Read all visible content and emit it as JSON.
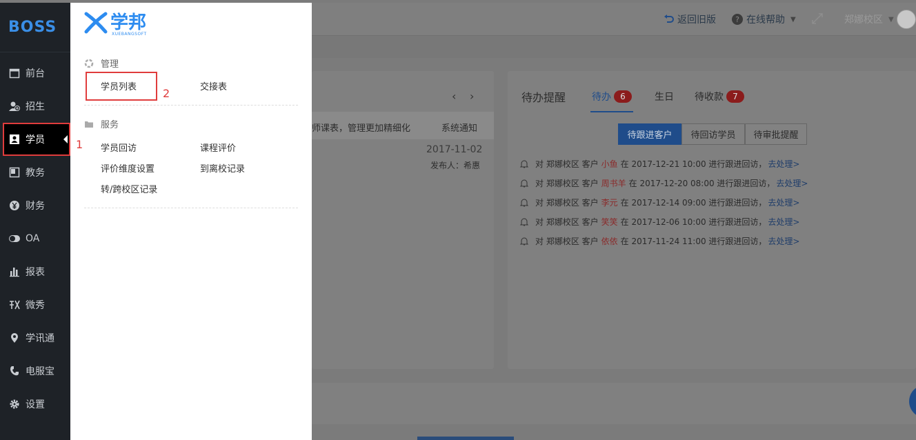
{
  "app": {
    "logo": "BOSS"
  },
  "sidebar": {
    "items": [
      {
        "label": "前台",
        "icon": "calendar-icon"
      },
      {
        "label": "招生",
        "icon": "user-add-icon"
      },
      {
        "label": "学员",
        "icon": "contact-card-icon"
      },
      {
        "label": "教务",
        "icon": "book-icon"
      },
      {
        "label": "财务",
        "icon": "yen-icon"
      },
      {
        "label": "OA",
        "icon": "toggle-icon"
      },
      {
        "label": "报表",
        "icon": "bar-chart-icon"
      },
      {
        "label": "微秀",
        "icon": "wei-xiu-icon"
      },
      {
        "label": "学讯通",
        "icon": "location-pin-icon"
      },
      {
        "label": "电服宝",
        "icon": "phone-icon"
      },
      {
        "label": "设置",
        "icon": "gear-icon"
      }
    ],
    "active_index": 2
  },
  "annotations": {
    "one": "1",
    "two": "2"
  },
  "submenu": {
    "brand_cn": "学邦",
    "brand_en": "XUEBANGSOFT",
    "sections": [
      {
        "title": "管理",
        "links": [
          "学员列表",
          "交接表"
        ]
      },
      {
        "title": "服务",
        "links": [
          "学员回访",
          "课程评价",
          "评价维度设置",
          "到离校记录",
          "转/跨校区记录"
        ]
      }
    ]
  },
  "topbar": {
    "back_old": "返回旧版",
    "help": "在线帮助",
    "campus": "郑娜校区"
  },
  "left_panel": {
    "notice_text": "师课表，管理更加精细化",
    "notice_tag": "系统通知",
    "date": "2017-11-02",
    "publisher": "发布人：希惠"
  },
  "right_panel": {
    "title": "待办提醒",
    "tabs": [
      {
        "label": "待办",
        "count": "6"
      },
      {
        "label": "生日",
        "count": ""
      },
      {
        "label": "待收款",
        "count": "7"
      }
    ],
    "segments": [
      "待跟进客户",
      "待回访学员",
      "待审批提醒"
    ],
    "todos": [
      {
        "prefix": "对 郑娜校区 客户",
        "name": "小鱼",
        "suffix": "在 2017-12-21 10:00 进行跟进回访，",
        "action": "去处理>"
      },
      {
        "prefix": "对 郑娜校区 客户",
        "name": "周书羊",
        "suffix": "在 2017-12-20 08:00 进行跟进回访，",
        "action": "去处理>"
      },
      {
        "prefix": "对 郑娜校区 客户",
        "name": "李元",
        "suffix": "在 2017-12-14 09:00 进行跟进回访，",
        "action": "去处理>"
      },
      {
        "prefix": "对 郑娜校区 客户",
        "name": "笑笑",
        "suffix": "在 2017-12-06 10:00 进行跟进回访，",
        "action": "去处理>"
      },
      {
        "prefix": "对 郑娜校区 客户",
        "name": "依依",
        "suffix": "在 2017-11-24 11:00 进行跟进回访，",
        "action": "去处理>"
      }
    ]
  }
}
